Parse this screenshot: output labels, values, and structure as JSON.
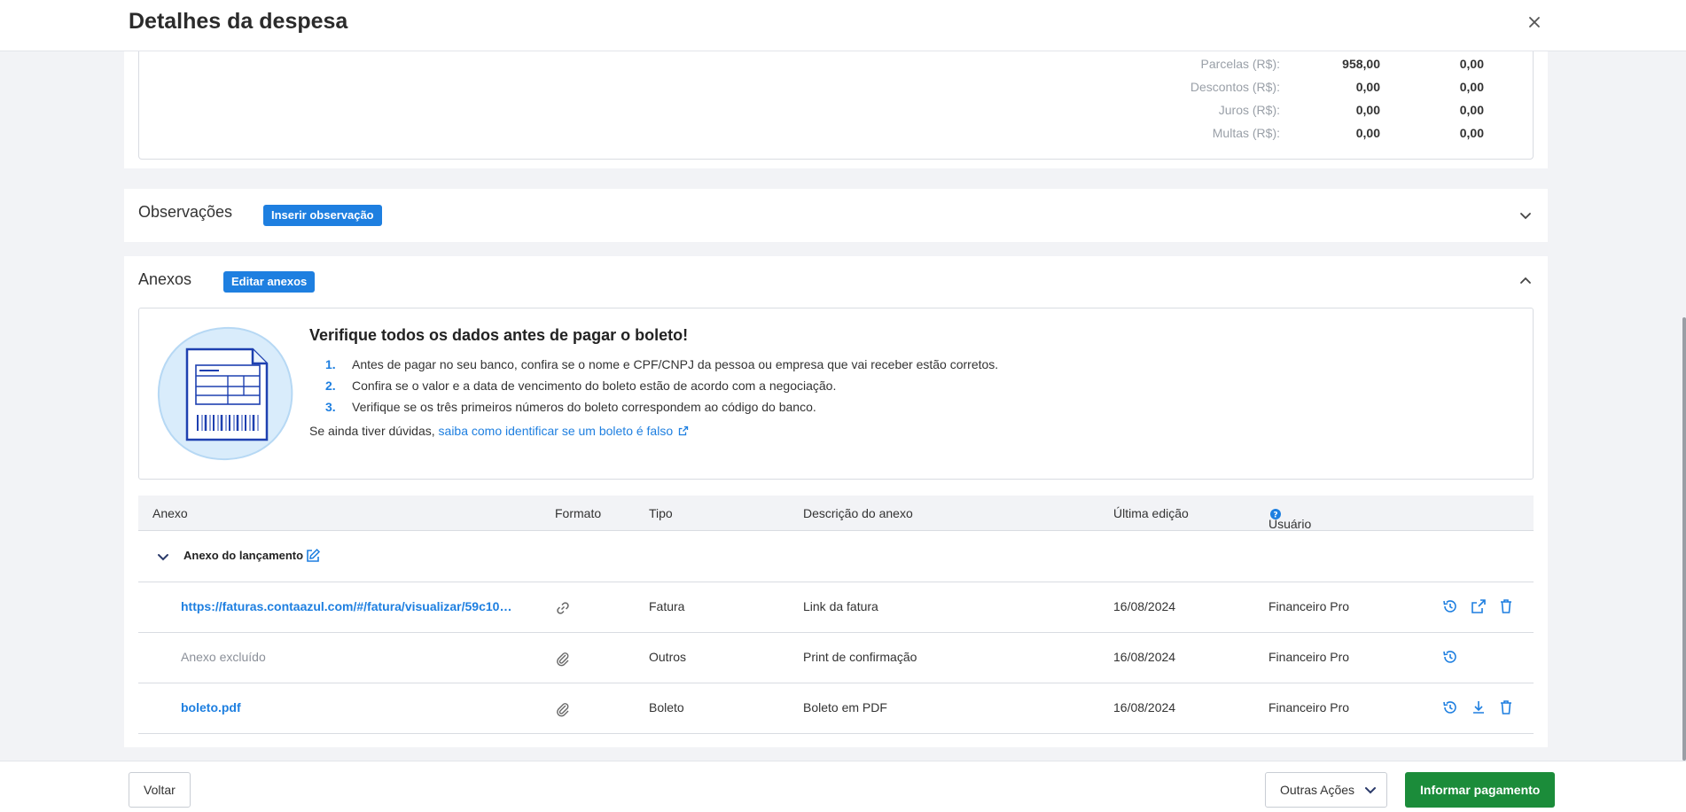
{
  "header": {
    "title": "Detalhes da despesa",
    "close_icon": "close-icon"
  },
  "totals": [
    {
      "label": "Parcelas (R$):",
      "value1": "958,00",
      "value2": "0,00"
    },
    {
      "label": "Descontos (R$):",
      "value1": "0,00",
      "value2": "0,00"
    },
    {
      "label": "Juros (R$):",
      "value1": "0,00",
      "value2": "0,00"
    },
    {
      "label": "Multas (R$):",
      "value1": "0,00",
      "value2": "0,00"
    }
  ],
  "observacoes": {
    "title": "Observações",
    "button": "Inserir observação"
  },
  "anexos": {
    "title": "Anexos",
    "button": "Editar anexos",
    "notice": {
      "heading": "Verifique todos os dados antes de pagar o boleto!",
      "items": [
        {
          "num": "1.",
          "text": "Antes de pagar no seu banco, confira se o nome e CPF/CNPJ da pessoa ou empresa que vai receber estão corretos."
        },
        {
          "num": "2.",
          "text": "Confira se o valor e a data de vencimento do boleto estão de acordo com a negociação."
        },
        {
          "num": "3.",
          "text": "Verifique se os três primeiros números do boleto correspondem ao código do banco."
        }
      ],
      "help_prefix": "Se ainda tiver dúvidas,",
      "help_link": "saiba como identificar se um boleto é falso"
    },
    "table": {
      "headers": {
        "anexo": "Anexo",
        "formato": "Formato",
        "tipo": "Tipo",
        "descricao": "Descrição do anexo",
        "ultima_edicao": "Última edição",
        "usuario": "Usuário"
      },
      "group_label": "Anexo do lançamento",
      "rows": [
        {
          "anexo": "https://faturas.contaazul.com/#/fatura/visualizar/59c10…",
          "formato_icon": "link-icon",
          "tipo": "Fatura",
          "descricao": "Link da fatura",
          "data": "16/08/2024",
          "usuario": "Financeiro Pro"
        },
        {
          "anexo": "Anexo excluído",
          "formato_icon": "paperclip-icon",
          "tipo": "Outros",
          "descricao": "Print de confirmação",
          "data": "16/08/2024",
          "usuario": "Financeiro Pro"
        },
        {
          "anexo": "boleto.pdf",
          "formato_icon": "paperclip-icon",
          "tipo": "Boleto",
          "descricao": "Boleto em PDF",
          "data": "16/08/2024",
          "usuario": "Financeiro Pro"
        }
      ]
    }
  },
  "footer": {
    "back": "Voltar",
    "more": "Outras Ações",
    "pay": "Informar pagamento"
  },
  "colors": {
    "accent": "#1e7fe0",
    "success": "#1b8c3a",
    "background": "#f2f3f6"
  }
}
